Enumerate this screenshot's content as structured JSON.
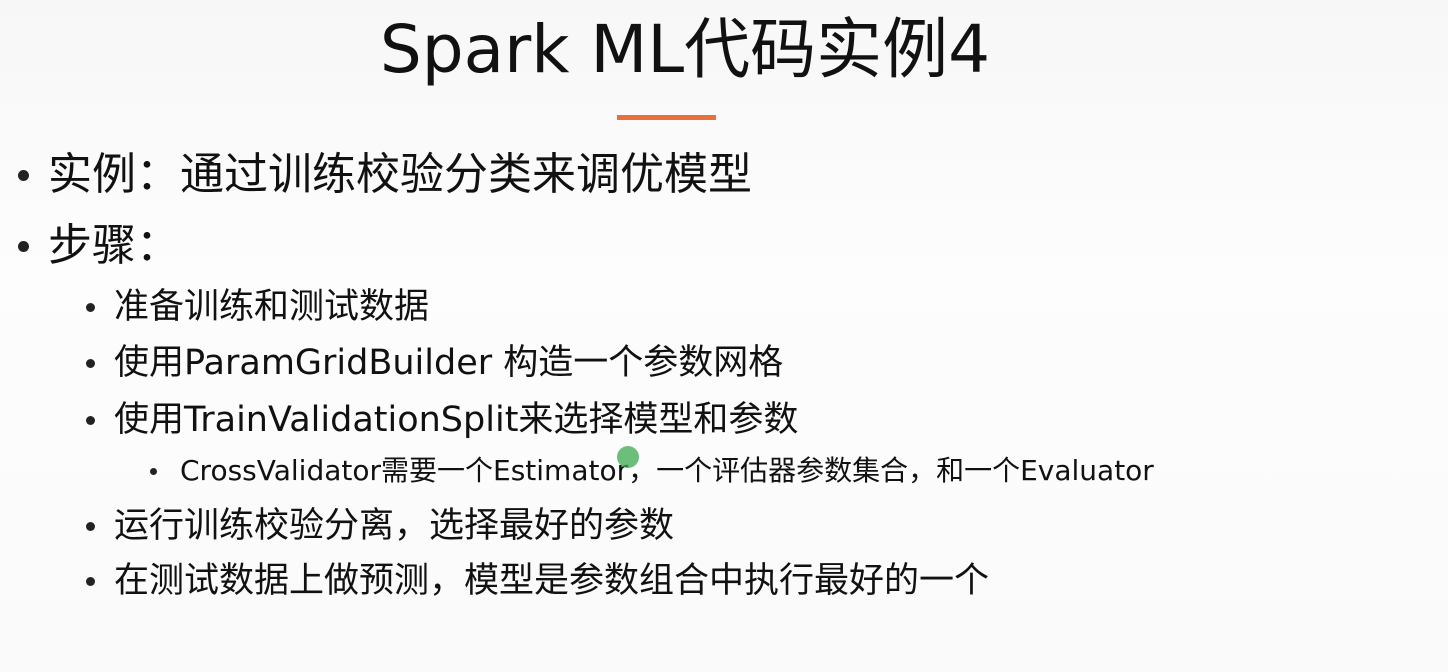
{
  "slide": {
    "title": "Spark ML代码实例4",
    "accent_color": "#e8703a",
    "bullets": [
      {
        "level": 1,
        "text": "实例：通过训练校验分类来调优模型"
      },
      {
        "level": 1,
        "text": "步骤："
      },
      {
        "level": 2,
        "text": "准备训练和测试数据"
      },
      {
        "level": 2,
        "text": "使用ParamGridBuilder 构造一个参数网格"
      },
      {
        "level": 2,
        "text": "使用TrainValidationSplit来选择模型和参数"
      },
      {
        "level": 3,
        "text": "CrossValidator需要一个Estimator，一个评估器参数集合，和一个Evaluator"
      },
      {
        "level": 2,
        "text": "运行训练校验分离，选择最好的参数"
      },
      {
        "level": 2,
        "text": "在测试数据上做预测，模型是参数组合中执行最好的一个"
      }
    ]
  }
}
